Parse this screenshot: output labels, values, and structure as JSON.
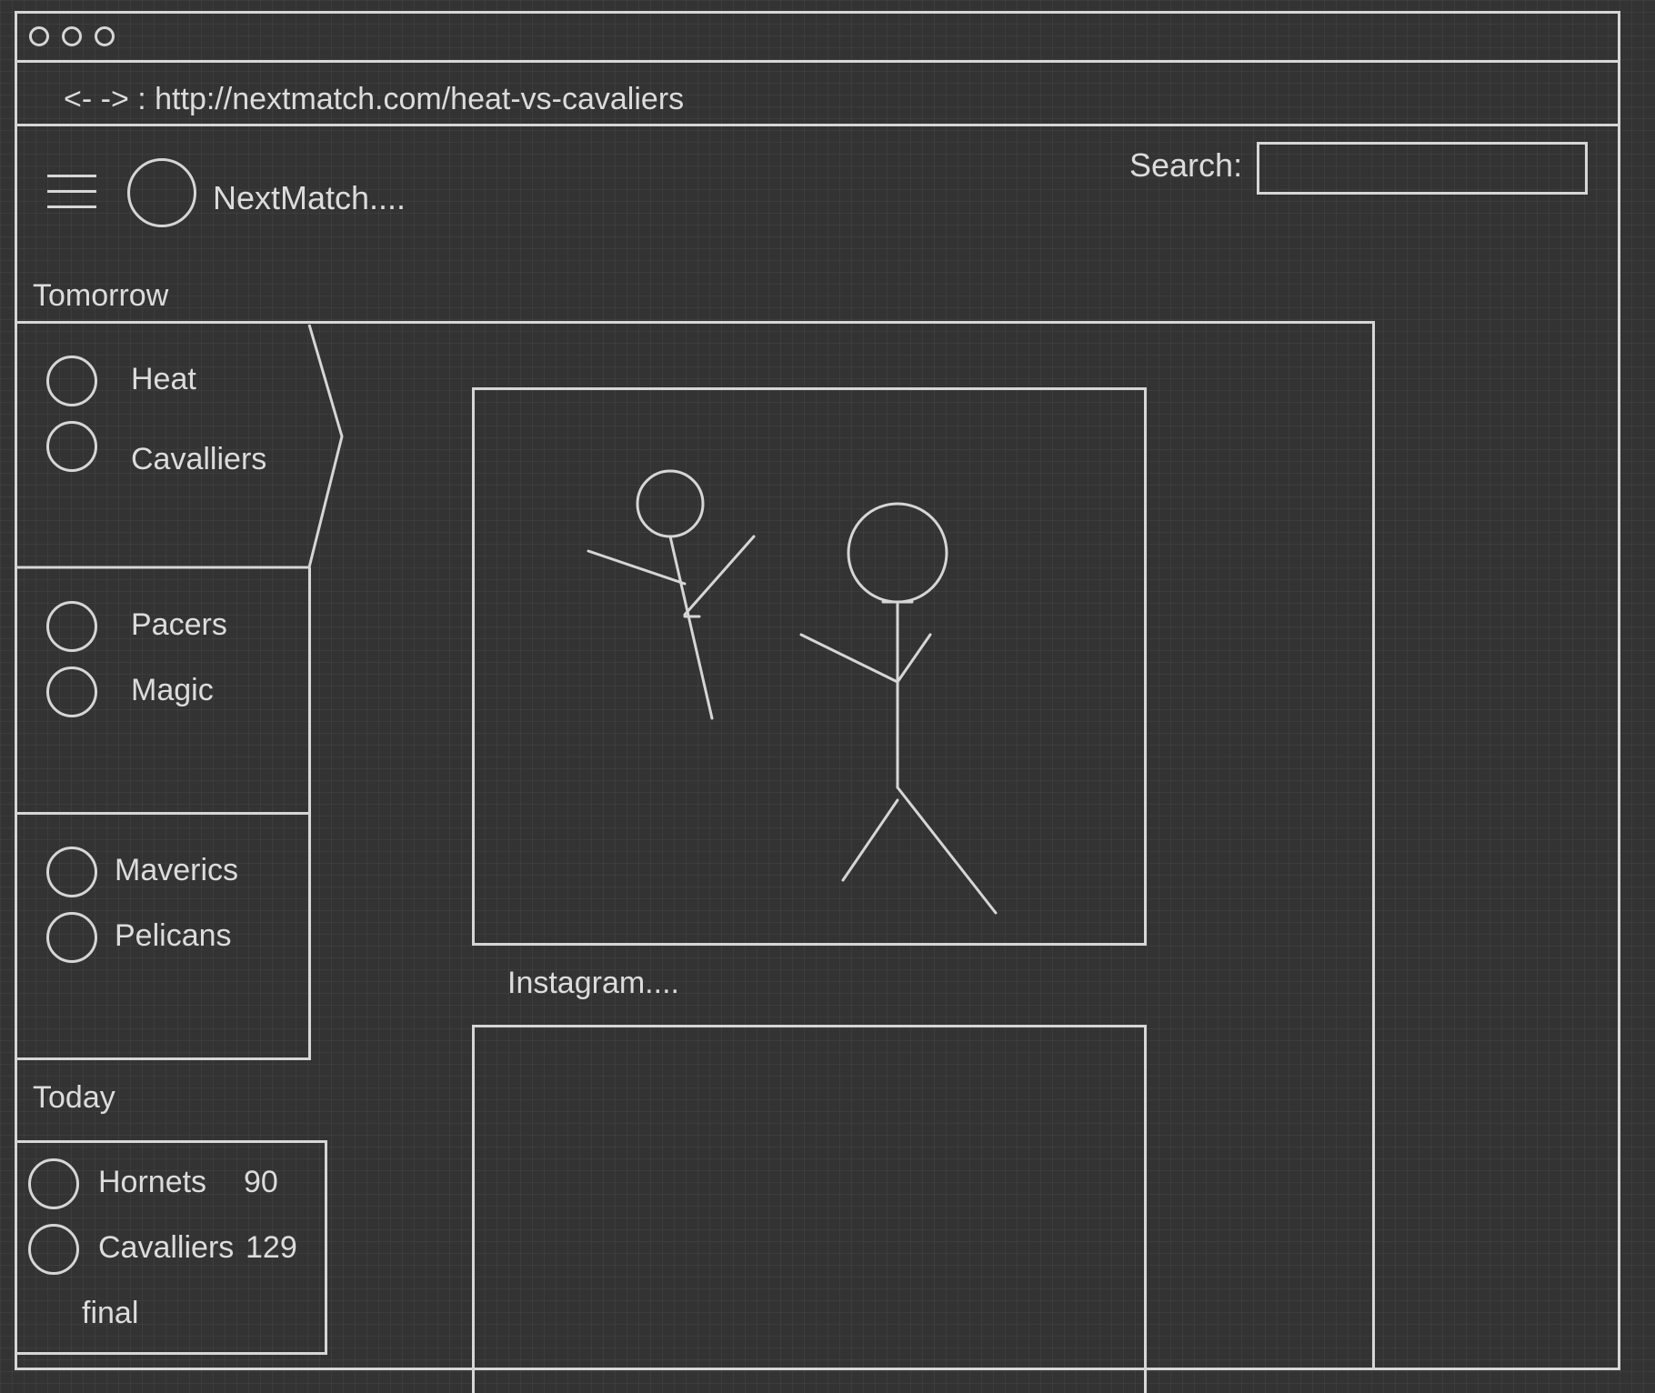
{
  "browser": {
    "address_bar": "<- -> : http://nextmatch.com/heat-vs-cavaliers"
  },
  "header": {
    "site_name": "NextMatch....",
    "search_label": "Search:",
    "search_value": ""
  },
  "tomorrow": {
    "heading": "Tomorrow",
    "matches": [
      {
        "team1": "Heat",
        "team2": "Cavalliers"
      },
      {
        "team1": "Pacers",
        "team2": "Magic"
      },
      {
        "team1": "Maverics",
        "team2": "Pelicans"
      }
    ]
  },
  "today": {
    "heading": "Today",
    "match": {
      "team1": "Hornets",
      "score1": "90",
      "team2": "Cavalliers",
      "score2": "129",
      "status": "final"
    }
  },
  "main": {
    "caption": "Instagram...."
  },
  "icons": {
    "menu": "hamburger-menu-icon",
    "logo": "circle-logo-icon",
    "team": "circle-team-logo-icon",
    "media": "stick-figure-image"
  },
  "colors": {
    "background": "#333333",
    "stroke": "#d6d6d6",
    "text": "#dcdcdc"
  }
}
